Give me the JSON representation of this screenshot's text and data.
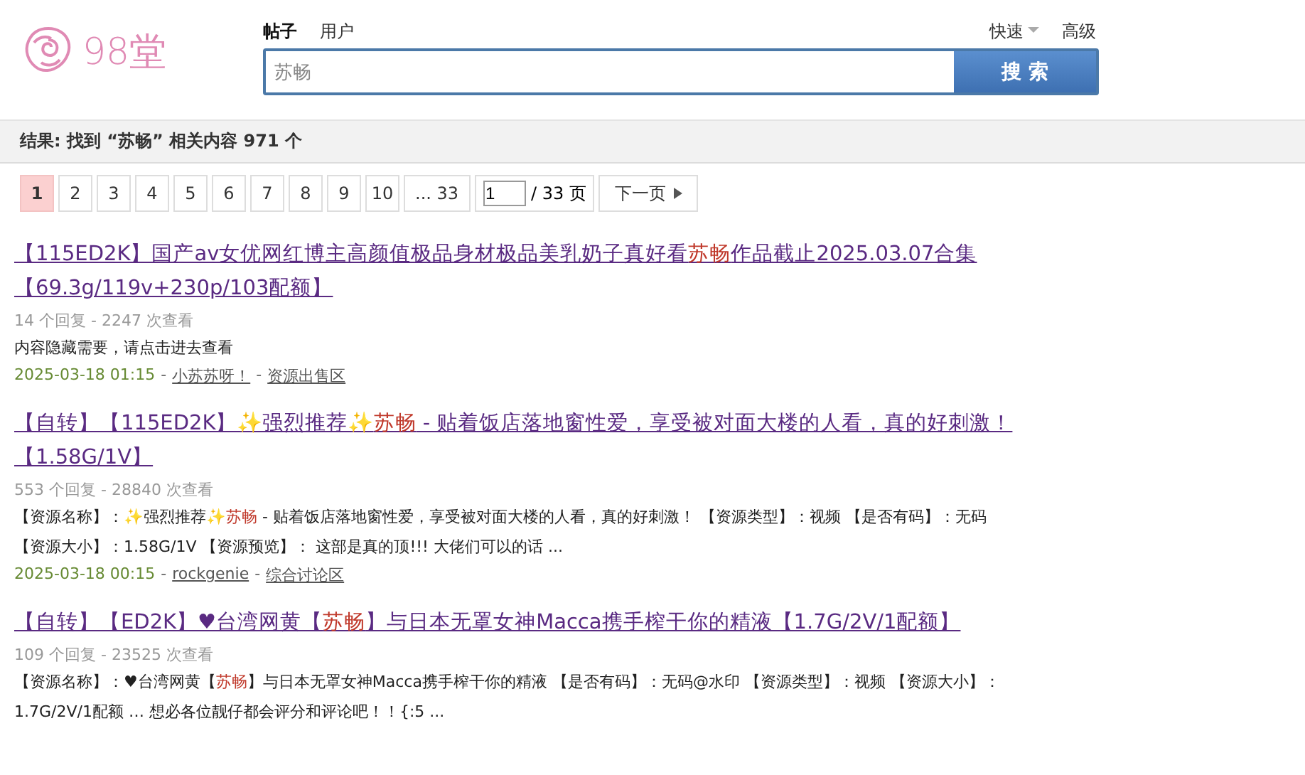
{
  "logo": {
    "text": "98堂"
  },
  "search": {
    "tabs": [
      {
        "label": "帖子",
        "selected": true
      },
      {
        "label": "用户",
        "selected": false
      }
    ],
    "quick": "快速",
    "advanced": "高级",
    "value": "苏畅",
    "button": "搜 索"
  },
  "summary": {
    "prefix": "结果: 找到",
    "keyword": "“苏畅”",
    "middle": "相关内容",
    "count": "971",
    "suffix": "个"
  },
  "pagination": {
    "pages": [
      {
        "label": "1",
        "selected": true
      },
      {
        "label": "2",
        "selected": false
      },
      {
        "label": "3",
        "selected": false
      },
      {
        "label": "4",
        "selected": false
      },
      {
        "label": "5",
        "selected": false
      },
      {
        "label": "6",
        "selected": false
      },
      {
        "label": "7",
        "selected": false
      },
      {
        "label": "8",
        "selected": false
      },
      {
        "label": "9",
        "selected": false
      },
      {
        "label": "10",
        "selected": false
      },
      {
        "label": "... 33",
        "selected": false
      }
    ],
    "page_input": "1",
    "total": "/ 33 页",
    "next": "下一页"
  },
  "results": [
    {
      "title": [
        {
          "text": "【115ED2K】国产av女优网红博主高颜值极品身材极品美乳奶子真好看",
          "highlight": false
        },
        {
          "text": "苏畅",
          "highlight": true
        },
        {
          "text": "作品截止2025.03.07合集【69.3g/119v+230p/103配额】",
          "highlight": false
        }
      ],
      "stats": "14 个回复 - 2247 次查看",
      "summary": [
        [
          {
            "text": "内容隐藏需要，请点击进去查看",
            "highlight": false
          }
        ]
      ],
      "meta": [
        {
          "kind": "date",
          "text": "2025-03-18 01:15"
        },
        {
          "kind": "separator",
          "text": "-"
        },
        {
          "kind": "link",
          "text": "小苏苏呀！"
        },
        {
          "kind": "separator",
          "text": "-"
        },
        {
          "kind": "link",
          "text": "资源出售区"
        }
      ]
    },
    {
      "title": [
        {
          "text": "【自转】【115ED2K】✨强烈推荐✨",
          "highlight": false
        },
        {
          "text": "苏畅",
          "highlight": true
        },
        {
          "text": " - 贴着饭店落地窗性爱，享受被对面大楼的人看，真的好刺激！【1.58G/1V】",
          "highlight": false
        }
      ],
      "stats": "553 个回复 - 28840 次查看",
      "summary": [
        [
          {
            "text": "【资源名称】：✨强烈推荐✨",
            "highlight": false
          },
          {
            "text": "苏畅",
            "highlight": true
          },
          {
            "text": " - 贴着饭店落地窗性爱，享受被对面大楼的人看，真的好刺激！ 【资源类型】：视频 【是否有码】：无码",
            "highlight": false
          }
        ],
        [
          {
            "text": "【资源大小】：1.58G/1V 【资源预览】： 这部是真的顶!!! 大佬们可以的话 ...",
            "highlight": false
          }
        ]
      ],
      "meta": [
        {
          "kind": "date",
          "text": "2025-03-18 00:15"
        },
        {
          "kind": "separator",
          "text": "-"
        },
        {
          "kind": "link",
          "text": "rockgenie"
        },
        {
          "kind": "separator",
          "text": "-"
        },
        {
          "kind": "link",
          "text": "综合讨论区"
        }
      ]
    },
    {
      "title": [
        {
          "text": "【自转】【ED2K】♥台湾网黄【",
          "highlight": false
        },
        {
          "text": "苏畅",
          "highlight": true
        },
        {
          "text": "】与日本无罩女神Macca携手榨干你的精液【1.7G/2V/1配额】",
          "highlight": false
        }
      ],
      "stats": "109 个回复 - 23525 次查看",
      "summary": [
        [
          {
            "text": "【资源名称】：♥台湾网黄【",
            "highlight": false
          },
          {
            "text": "苏畅",
            "highlight": true
          },
          {
            "text": "】与日本无罩女神Macca携手榨干你的精液 【是否有码】：无码@水印 【资源类型】：视频 【资源大小】：",
            "highlight": false
          }
        ],
        [
          {
            "text": "1.7G/2V/1配额 … 想必各位靓仔都会评分和评论吧！！{:5 ...",
            "highlight": false
          }
        ]
      ]
    }
  ]
}
